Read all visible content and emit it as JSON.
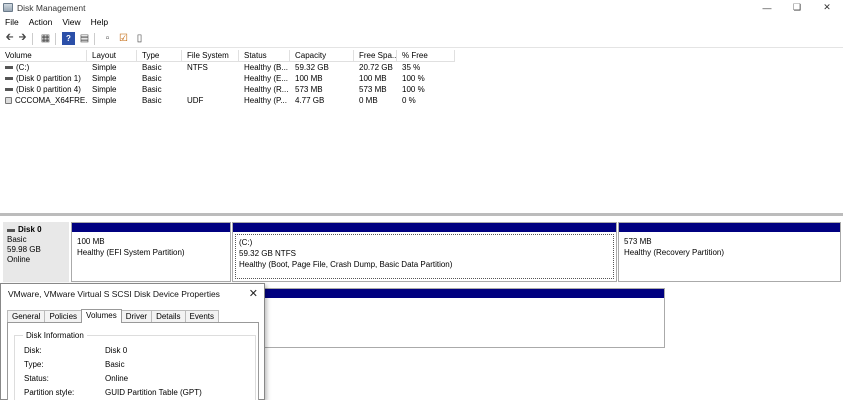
{
  "window": {
    "title": "Disk Management"
  },
  "menu": [
    "File",
    "Action",
    "View",
    "Help"
  ],
  "toolbar": {
    "icons": [
      "back-arrow-icon",
      "forward-arrow-icon",
      "list-view-icon",
      "help-icon",
      "properties-icon",
      "connect-icon",
      "check-icon",
      "more-icon"
    ]
  },
  "volumes": {
    "headers": [
      "Volume",
      "Layout",
      "Type",
      "File System",
      "Status",
      "Capacity",
      "Free Spa...",
      "% Free"
    ],
    "rows": [
      [
        "(C:)",
        "Simple",
        "Basic",
        "NTFS",
        "Healthy (B...",
        "59.32 GB",
        "20.72 GB",
        "35 %"
      ],
      [
        "(Disk 0 partition 1)",
        "Simple",
        "Basic",
        "",
        "Healthy (E...",
        "100 MB",
        "100 MB",
        "100 %"
      ],
      [
        "(Disk 0 partition 4)",
        "Simple",
        "Basic",
        "",
        "Healthy (R...",
        "573 MB",
        "573 MB",
        "100 %"
      ],
      [
        "CCCOMA_X64FRE...",
        "Simple",
        "Basic",
        "UDF",
        "Healthy (P...",
        "4.77 GB",
        "0 MB",
        "0 %"
      ]
    ]
  },
  "disk0": {
    "name": "Disk 0",
    "type": "Basic",
    "size": "59.98 GB",
    "status": "Online",
    "partitions": [
      {
        "line1": "100 MB",
        "line2": "Healthy (EFI System Partition)"
      },
      {
        "line0": "(C:)",
        "line1": "59.32 GB NTFS",
        "line2": "Healthy (Boot, Page File, Crash Dump, Basic Data Partition)"
      },
      {
        "line1": "573 MB",
        "line2": "Healthy (Recovery Partition)"
      }
    ]
  },
  "dialog": {
    "title": "VMware, VMware Virtual S SCSI Disk Device Properties",
    "tabs": [
      "General",
      "Policies",
      "Volumes",
      "Driver",
      "Details",
      "Events"
    ],
    "active_tab": "Volumes",
    "group_title": "Disk Information",
    "fields": [
      {
        "label": "Disk:",
        "value": "Disk 0"
      },
      {
        "label": "Type:",
        "value": "Basic"
      },
      {
        "label": "Status:",
        "value": "Online"
      },
      {
        "label": "Partition style:",
        "value": "GUID Partition Table (GPT)"
      }
    ]
  },
  "colors": {
    "partition_bar": "#000080"
  }
}
